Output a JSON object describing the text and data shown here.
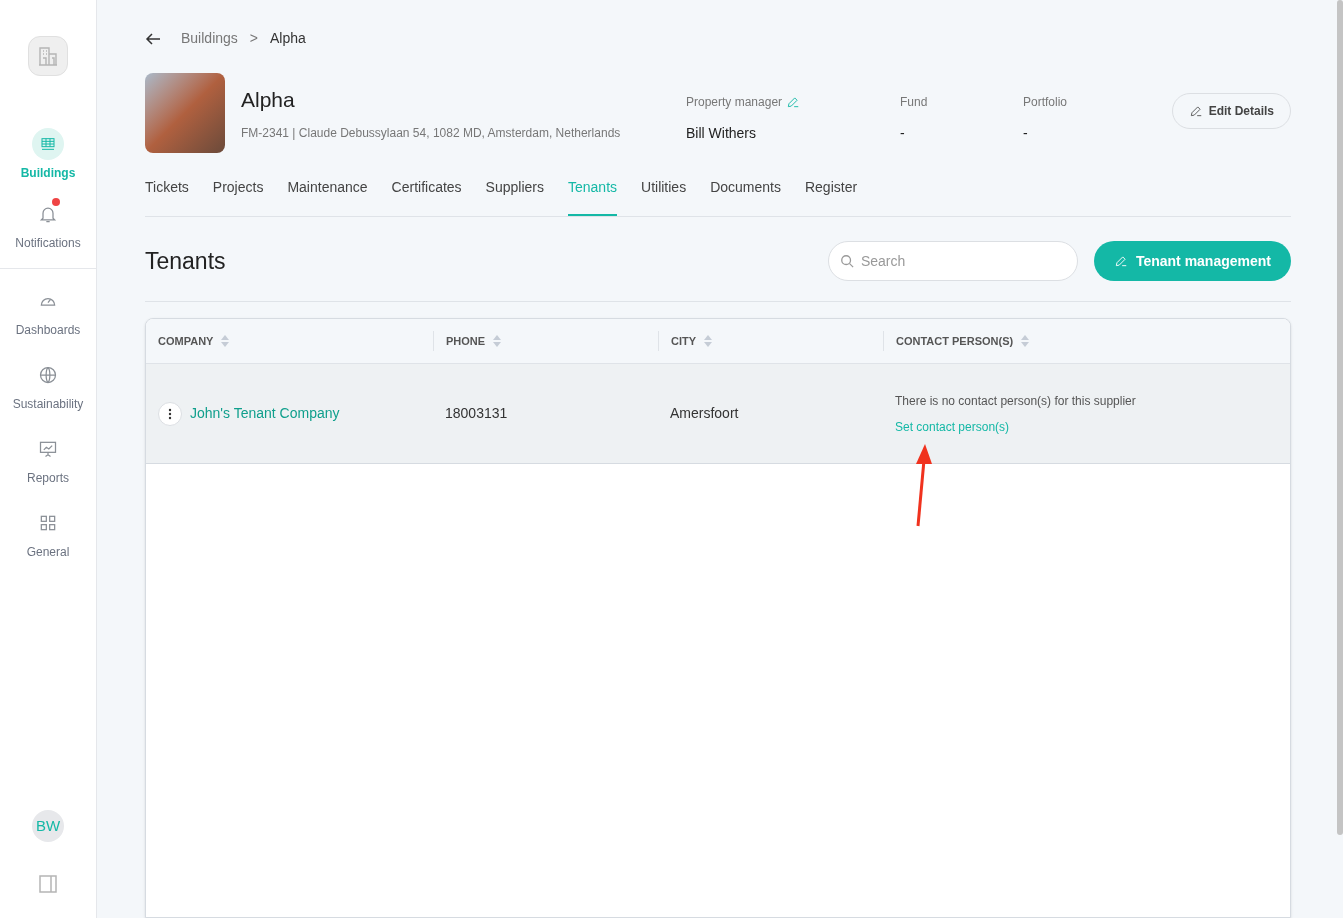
{
  "sidebar": {
    "avatar": "BW",
    "sections": [
      {
        "items": [
          {
            "label": "Buildings",
            "selected": true,
            "alert": false
          },
          {
            "label": "Notifications",
            "selected": false,
            "alert": true
          }
        ]
      },
      {
        "items": [
          {
            "label": "Dashboards",
            "selected": false,
            "alert": false
          },
          {
            "label": "Sustainability",
            "selected": false,
            "alert": false
          },
          {
            "label": "Reports",
            "selected": false,
            "alert": false
          },
          {
            "label": "General",
            "selected": false,
            "alert": false
          }
        ]
      }
    ]
  },
  "breadcrumb": [
    "Buildings",
    ">",
    "Alpha"
  ],
  "building": {
    "name": "Alpha",
    "address": "FM-2341 | Claude Debussylaan 54, 1082 MD, Amsterdam, Netherlands",
    "fields": [
      {
        "label": "Property manager",
        "value": "Bill Withers",
        "editable": true
      },
      {
        "label": "Fund",
        "value": "-",
        "editable": false
      },
      {
        "label": "Portfolio",
        "value": "-",
        "editable": false
      }
    ],
    "edit_button": "Edit Details"
  },
  "tabs": [
    {
      "label": "Tickets",
      "selected": false
    },
    {
      "label": "Projects",
      "selected": false
    },
    {
      "label": "Maintenance",
      "selected": false
    },
    {
      "label": "Certificates",
      "selected": false
    },
    {
      "label": "Suppliers",
      "selected": false
    },
    {
      "label": "Tenants",
      "selected": true
    },
    {
      "label": "Utilities",
      "selected": false
    },
    {
      "label": "Documents",
      "selected": false
    },
    {
      "label": "Register",
      "selected": false
    }
  ],
  "section": {
    "title": "Tenants",
    "search": {
      "placeholder": "Search"
    },
    "action_button": "Tenant management"
  },
  "table": {
    "columns": [
      "COMPANY",
      "PHONE",
      "CITY",
      "CONTACT PERSON(S)"
    ],
    "rows": [
      {
        "selected": true,
        "company": "John's Tenant Company",
        "phone": "18003131",
        "city": "Amersfoort",
        "contact_note": "There is no contact person(s) for this supplier",
        "contact_link": "Set contact person(s)"
      }
    ]
  }
}
